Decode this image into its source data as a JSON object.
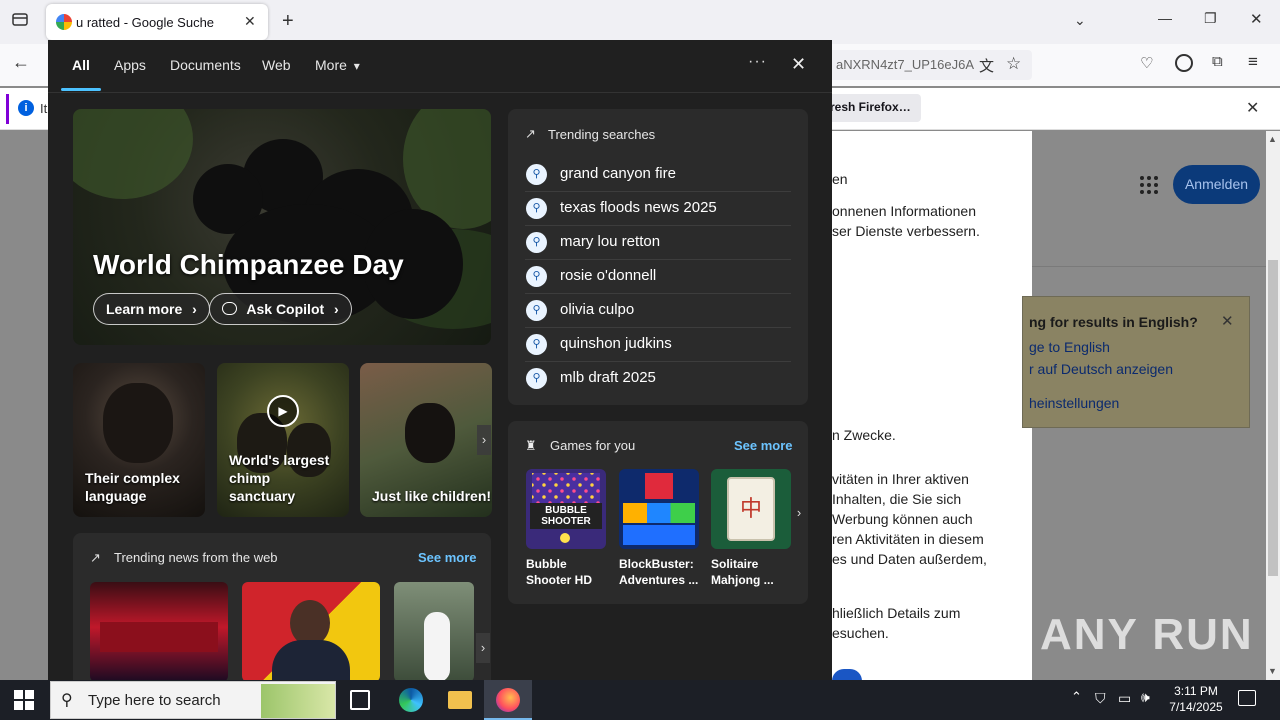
{
  "browser": {
    "tab_title": "u ratted - Google Suche",
    "tab_close": "✕",
    "new_tab": "+",
    "url_fragment": "aNXRN4zt7_UP16eJ6A",
    "notification_prefix": "It",
    "notification_button": "resh Firefox…",
    "window_controls": {
      "minimize": "—",
      "maximize": "❐",
      "close": "✕"
    }
  },
  "page": {
    "sign_in": "Anmelden",
    "lines": [
      "en",
      "onnenen Informationen",
      "ser Dienste verbessern.",
      "n Zwecke.",
      "vitäten in Ihrer aktiven",
      "Inhalten, die Sie sich",
      "Werbung können auch",
      "ren Aktivitäten in diesem",
      "es und Daten außerdem,",
      "hließlich Details zum",
      "esuchen."
    ],
    "lang_card": {
      "title": "ng for results in English?",
      "link1": "ge to English",
      "link2": "r auf Deutsch anzeigen",
      "link3": "heinstellungen",
      "close": "✕"
    },
    "watermark": "ANY RUN"
  },
  "widget": {
    "nav_tabs": [
      "All",
      "Apps",
      "Documents",
      "Web",
      "More"
    ],
    "more_caret": "▾",
    "menu_dots": "···",
    "close": "✕",
    "hero": {
      "title": "World Chimpanzee Day",
      "learn_more": "Learn more",
      "ask_copilot": "Ask Copilot",
      "chevron": "›"
    },
    "thumbs": [
      {
        "caption": "Their complex language"
      },
      {
        "caption": "World's largest chimp sanctuary"
      },
      {
        "caption": "Just like children!"
      }
    ],
    "trending": {
      "title": "Trending searches",
      "items": [
        "grand canyon fire",
        "texas floods news 2025",
        "mary lou retton",
        "rosie o'donnell",
        "olivia culpo",
        "quinshon judkins",
        "mlb draft 2025"
      ]
    },
    "games": {
      "title": "Games for you",
      "see_more": "See more",
      "items": [
        {
          "name": "Bubble Shooter HD",
          "art_text": "BUBBLE SHOOTER"
        },
        {
          "name": "BlockBuster: Adventures ..."
        },
        {
          "name": "Solitaire Mahjong ..."
        }
      ]
    },
    "news": {
      "title": "Trending news from the web",
      "see_more": "See more"
    }
  },
  "taskbar": {
    "search_placeholder": "Type here to search",
    "time": "3:11 PM",
    "date": "7/14/2025"
  },
  "colors": {
    "panel_bg": "#202020",
    "card_bg": "#2b2b2b",
    "accent": "#4cc2ff",
    "link": "#6cc4ff",
    "signin_bg": "#0b57d0"
  }
}
